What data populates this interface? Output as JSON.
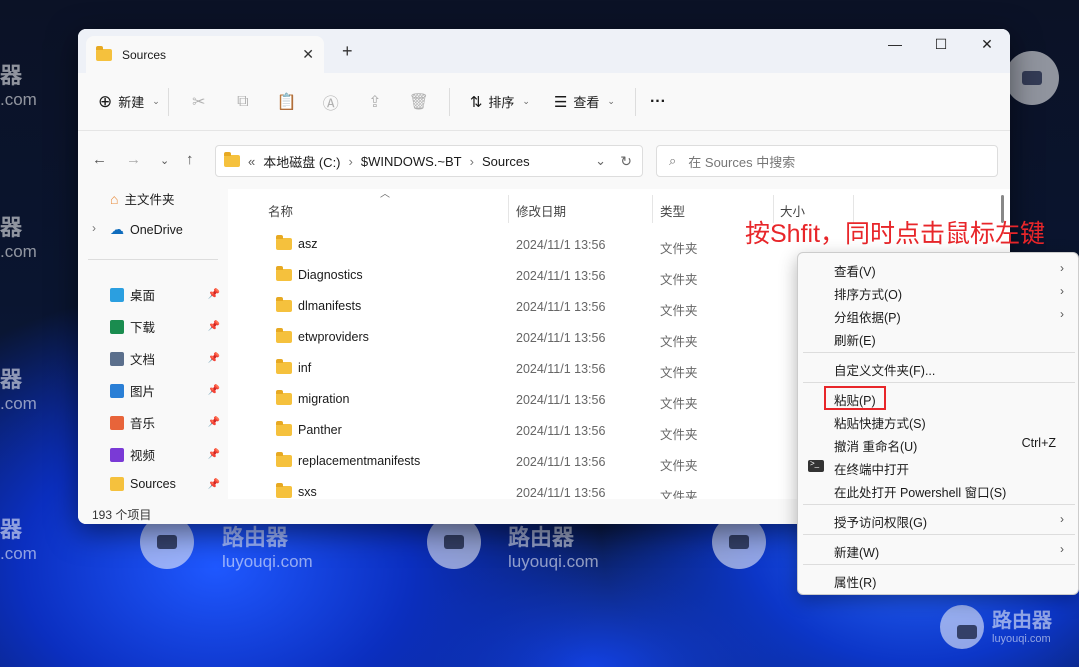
{
  "watermark": {
    "brand": "路由器",
    "site": "luyouqi.com",
    "left_brand": "器",
    "left_site": ".com"
  },
  "window": {
    "tab_title": "Sources",
    "toolbar": {
      "new_label": "新建",
      "sort_label": "排序",
      "view_label": "查看",
      "more": "···"
    },
    "address": {
      "prefix": "«",
      "path": [
        "本地磁盘 (C:)",
        "$WINDOWS.~BT",
        "Sources"
      ]
    },
    "search_placeholder": "在 Sources 中搜索",
    "sidebar": {
      "home": "主文件夹",
      "onedrive": "OneDrive",
      "pinned": [
        {
          "label": "桌面",
          "color": "#2b9fe0"
        },
        {
          "label": "下载",
          "color": "#1a8c4f"
        },
        {
          "label": "文档",
          "color": "#5b6f8c"
        },
        {
          "label": "图片",
          "color": "#2a7fd6"
        },
        {
          "label": "音乐",
          "color": "#e8643a"
        },
        {
          "label": "视频",
          "color": "#7a3ad6"
        },
        {
          "label": "Sources",
          "color": "#f5c13d"
        }
      ]
    },
    "columns": {
      "name": "名称",
      "date": "修改日期",
      "type": "类型",
      "size": "大小"
    },
    "files": [
      {
        "name": "asz",
        "date": "2024/11/1 13:56",
        "type": "文件夹"
      },
      {
        "name": "Diagnostics",
        "date": "2024/11/1 13:56",
        "type": "文件夹"
      },
      {
        "name": "dlmanifests",
        "date": "2024/11/1 13:56",
        "type": "文件夹"
      },
      {
        "name": "etwproviders",
        "date": "2024/11/1 13:56",
        "type": "文件夹"
      },
      {
        "name": "inf",
        "date": "2024/11/1 13:56",
        "type": "文件夹"
      },
      {
        "name": "migration",
        "date": "2024/11/1 13:56",
        "type": "文件夹"
      },
      {
        "name": "Panther",
        "date": "2024/11/1 13:56",
        "type": "文件夹"
      },
      {
        "name": "replacementmanifests",
        "date": "2024/11/1 13:56",
        "type": "文件夹"
      },
      {
        "name": "sxs",
        "date": "2024/11/1 13:56",
        "type": "文件夹"
      }
    ],
    "status": "193 个项目"
  },
  "annotation": "按Shfit，同时点击鼠标左键",
  "context_menu": {
    "view": "查看(V)",
    "sort": "排序方式(O)",
    "group": "分组依据(P)",
    "refresh": "刷新(E)",
    "customize": "自定义文件夹(F)...",
    "paste": "粘贴(P)",
    "paste_shortcut": "粘贴快捷方式(S)",
    "undo": "撤消 重命名(U)",
    "undo_shortcut": "Ctrl+Z",
    "terminal": "在终端中打开",
    "powershell": "在此处打开 Powershell 窗口(S)",
    "access": "授予访问权限(G)",
    "new": "新建(W)",
    "properties": "属性(R)"
  },
  "colors": {
    "accent": "#e8262a",
    "folder": "#f5c13d",
    "onedrive": "#0f6cbd"
  }
}
